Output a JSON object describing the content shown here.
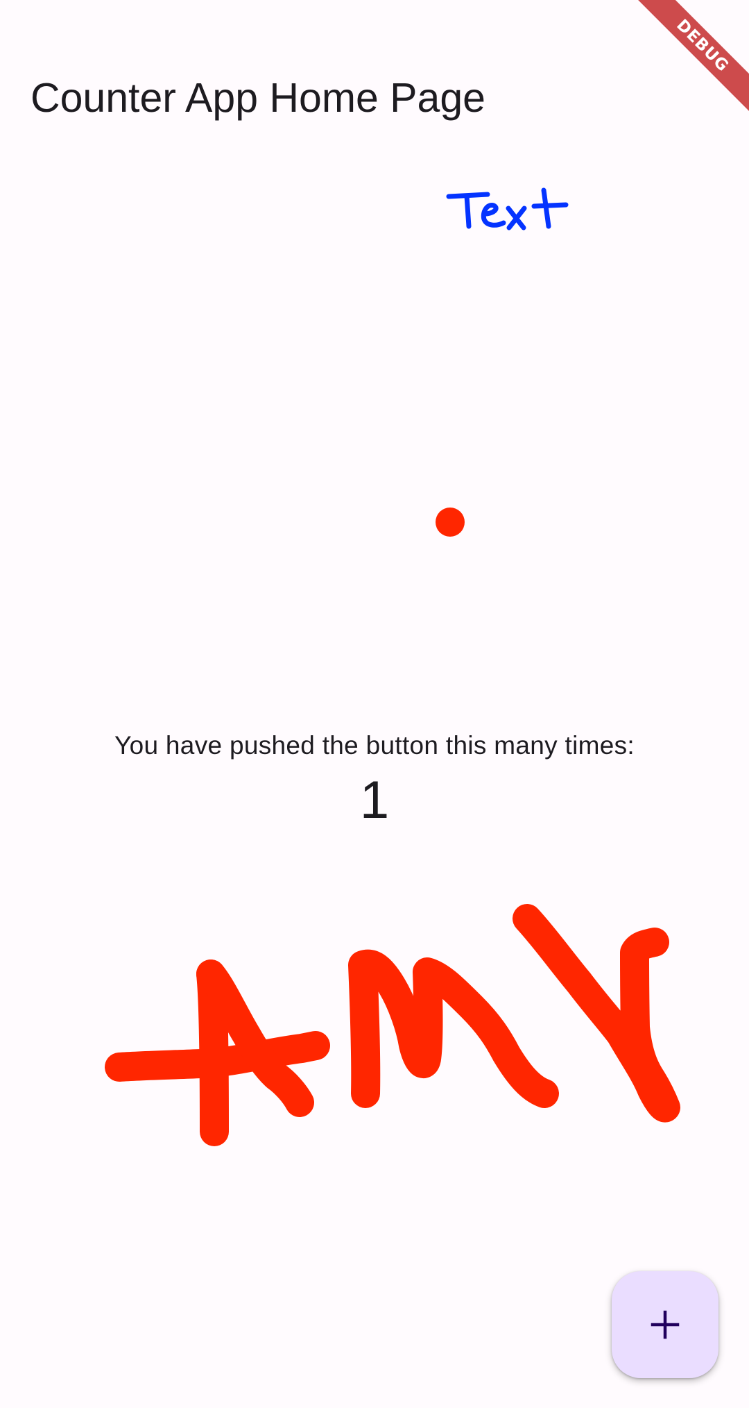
{
  "app_bar": {
    "title": "Counter App Home Page"
  },
  "debug_banner": {
    "label": "DEBUG"
  },
  "canvas": {
    "ink_colors": {
      "red": "#ff2600",
      "blue": "#0433ff"
    },
    "handwritten_text": [
      "Text",
      "+MY"
    ]
  },
  "counter": {
    "label": "You have pushed the button this many times:",
    "value": "1"
  },
  "fab": {
    "icon": "add-icon",
    "background": "#eaddff",
    "icon_color": "#21005d"
  }
}
